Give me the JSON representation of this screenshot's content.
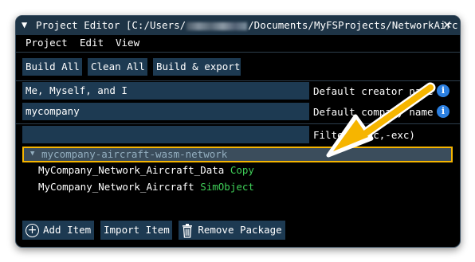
{
  "window": {
    "title_prefix": "Project Editor [C:/Users/",
    "title_suffix": "/Documents/MyFSProjects/NetworkAirc",
    "collapse_icon": "triangle-down-icon",
    "close_icon": "close-icon"
  },
  "menu": [
    "Project",
    "Edit",
    "View"
  ],
  "toolbar": {
    "build_all": "Build All",
    "clean_all": "Clean All",
    "build_export": "Build & export"
  },
  "fields": {
    "creator_value": "Me, Myself, and I",
    "creator_label": "Default creator name",
    "company_value": "mycompany",
    "company_label": "Default company name",
    "filter_value": "",
    "filter_label": "Filter (inc,-exc)"
  },
  "tree": {
    "package_name": "mycompany-aircraft-wasm-network",
    "items": [
      {
        "name": "MyCompany_Network_Aircraft_Data",
        "type": "Copy"
      },
      {
        "name": "MyCompany_Network_Aircraft",
        "type": "SimObject"
      }
    ]
  },
  "bottom_buttons": {
    "add_item": "Add Item",
    "import_item": "Import Item",
    "remove_package": "Remove Package"
  },
  "colors": {
    "title_bg": "#1e3446",
    "button_bg": "#1d3a52",
    "highlight_border": "#f6b500",
    "arrow": "#f6b500",
    "type_text": "#3fcf58",
    "info_icon": "#2b7fe0"
  }
}
